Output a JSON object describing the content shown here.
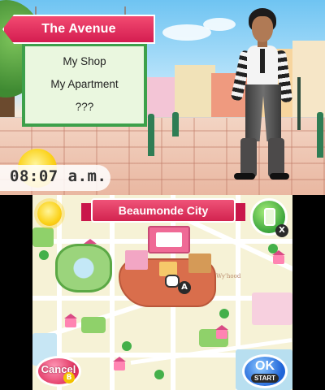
{
  "top_screen": {
    "location_title": "The Avenue",
    "menu": [
      {
        "label": "My Shop"
      },
      {
        "label": "My Apartment"
      },
      {
        "label": "???"
      }
    ],
    "clock": "08:07 a.m."
  },
  "bottom_screen": {
    "city_title": "Beaumonde City",
    "map_label": "Wy'hood",
    "phone_button_key": "X",
    "cursor_key": "A",
    "cancel_button": {
      "label": "Cancel",
      "key": "B"
    },
    "ok_button": {
      "label": "OK",
      "key": "START"
    }
  },
  "colors": {
    "banner_pink": "#d41d50",
    "menu_green": "#3da04a",
    "ok_blue": "#1f64d8",
    "cancel_pink": "#e0305e"
  },
  "icons": [
    "sun-icon",
    "phone-icon",
    "hand-cursor-icon"
  ]
}
